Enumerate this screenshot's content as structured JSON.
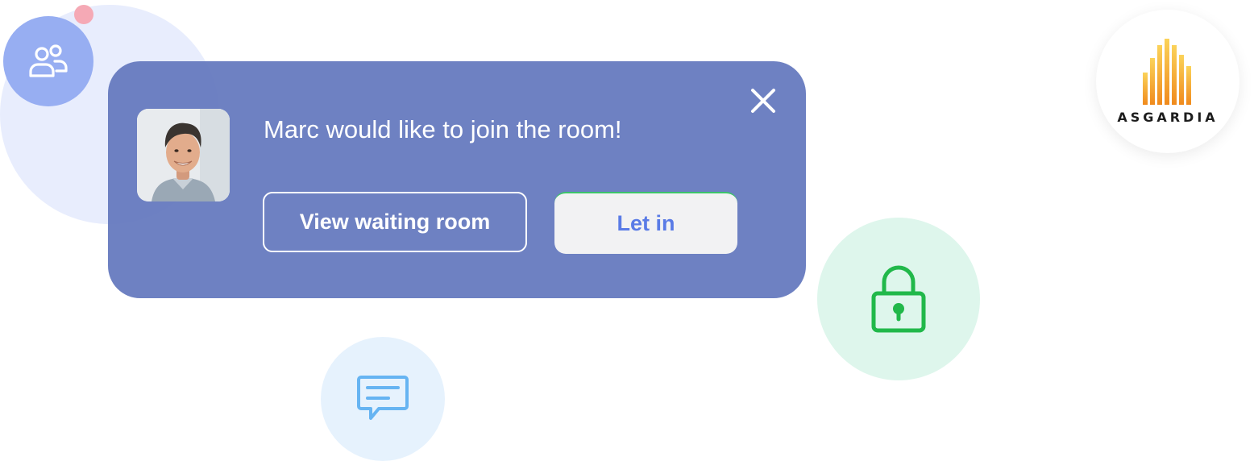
{
  "notification": {
    "message": "Marc would like to join the room!",
    "view_waiting_room_label": "View waiting room",
    "let_in_label": "Let in",
    "avatar": "user-photo",
    "close_icon": "close-icon"
  },
  "brand": {
    "name": "ASGARDIA",
    "accent": "#f29a1d"
  },
  "icons": {
    "users": "users-icon",
    "lock": "lock-icon",
    "chat": "chat-icon"
  },
  "colors": {
    "card": "#6276bd",
    "let_in_text": "#5a7be6",
    "lock": "#21b84a",
    "chat": "#66b4f2",
    "notification_dot": "#f5a9b5"
  }
}
